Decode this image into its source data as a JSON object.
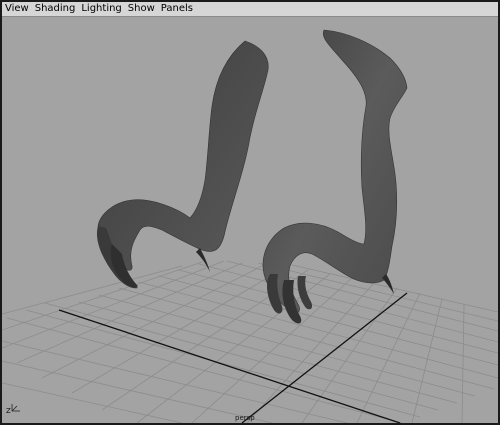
{
  "menubar": {
    "items": [
      "View",
      "Shading",
      "Lighting",
      "Show",
      "Panels"
    ]
  },
  "viewport": {
    "camera_label": "persp",
    "axis_label": "Z"
  },
  "colors": {
    "background": "#a3a3a3",
    "grid_line": "#8c8c8c",
    "grid_axis": "#111111",
    "model": "#4a4a4a"
  }
}
